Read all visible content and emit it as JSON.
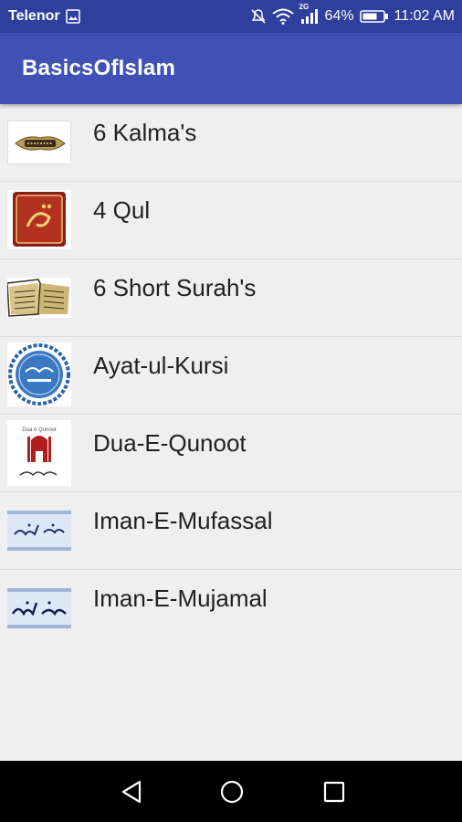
{
  "status_bar": {
    "carrier": "Telenor",
    "network": "2G",
    "battery_percent": "64%",
    "time": "11:02 AM",
    "icons": [
      "image-icon",
      "mute-icon",
      "wifi-icon",
      "signal-icon",
      "battery-icon"
    ]
  },
  "app_bar": {
    "title": "BasicsOfIslam",
    "color": "#3f51b5"
  },
  "list": {
    "items": [
      {
        "label": "6 Kalma's",
        "icon": "kalma-thumbnail-icon"
      },
      {
        "label": "4 Qul",
        "icon": "qul-thumbnail-icon"
      },
      {
        "label": "6 Short Surah's",
        "icon": "quran-book-thumbnail-icon"
      },
      {
        "label": "Ayat-ul-Kursi",
        "icon": "ayat-ul-kursi-thumbnail-icon"
      },
      {
        "label": "Dua-E-Qunoot",
        "icon": "dua-e-qunoot-thumbnail-icon",
        "thumb_text": "Dua e Qunoot"
      },
      {
        "label": "Iman-E-Mufassal",
        "icon": "iman-e-mufassal-thumbnail-icon"
      },
      {
        "label": "Iman-E-Mujamal",
        "icon": "iman-e-mujamal-thumbnail-icon"
      }
    ]
  },
  "nav_bar": {
    "icons": [
      "back-icon",
      "home-icon",
      "recents-icon"
    ]
  }
}
